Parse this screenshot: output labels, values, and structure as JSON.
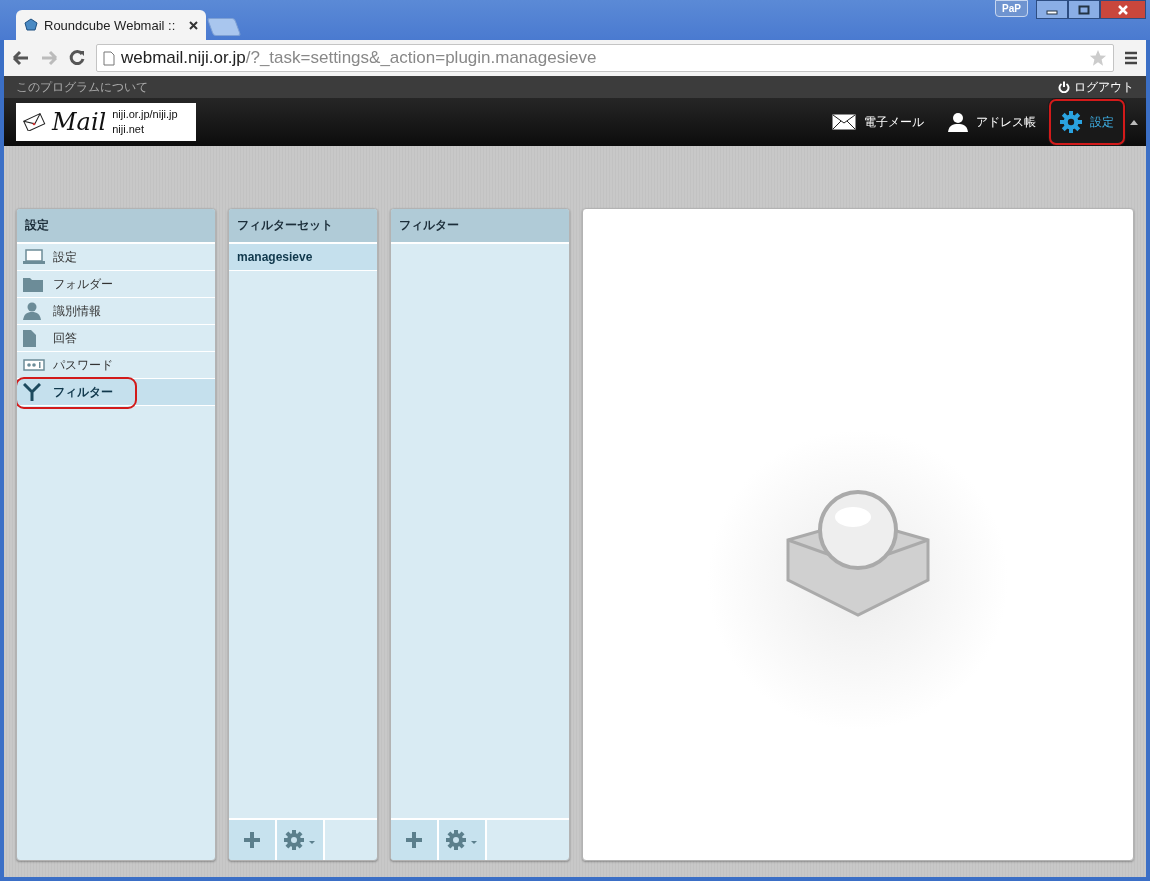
{
  "browser": {
    "tab_title": "Roundcube Webmail ::",
    "badge": "PaP",
    "url_host": "webmail.niji.or.jp",
    "url_path": "/?_task=settings&_action=plugin.managesieve"
  },
  "topline": {
    "about": "このプログラムについて",
    "logout": "ログアウト"
  },
  "logo": {
    "wordmark": "Mail",
    "lines": [
      "niji.or.jp/niji.jp",
      "niji.net"
    ]
  },
  "nav": [
    {
      "kind": "mail",
      "label": "電子メール",
      "selected": false,
      "highlighted": false
    },
    {
      "kind": "contacts",
      "label": "アドレス帳",
      "selected": false,
      "highlighted": false
    },
    {
      "kind": "settings",
      "label": "設定",
      "selected": true,
      "highlighted": true
    }
  ],
  "settings_panel": {
    "header": "設定",
    "items": [
      {
        "kind": "preferences",
        "label": "設定",
        "selected": false,
        "highlighted": false
      },
      {
        "kind": "folders",
        "label": "フォルダー",
        "selected": false,
        "highlighted": false
      },
      {
        "kind": "identities",
        "label": "識別情報",
        "selected": false,
        "highlighted": false
      },
      {
        "kind": "responses",
        "label": "回答",
        "selected": false,
        "highlighted": false
      },
      {
        "kind": "password",
        "label": "パスワード",
        "selected": false,
        "highlighted": false
      },
      {
        "kind": "filters",
        "label": "フィルター",
        "selected": true,
        "highlighted": true
      }
    ]
  },
  "filtersets_panel": {
    "header": "フィルターセット",
    "items": [
      {
        "label": "managesieve",
        "selected": true
      }
    ]
  },
  "filters_panel": {
    "header": "フィルター"
  }
}
